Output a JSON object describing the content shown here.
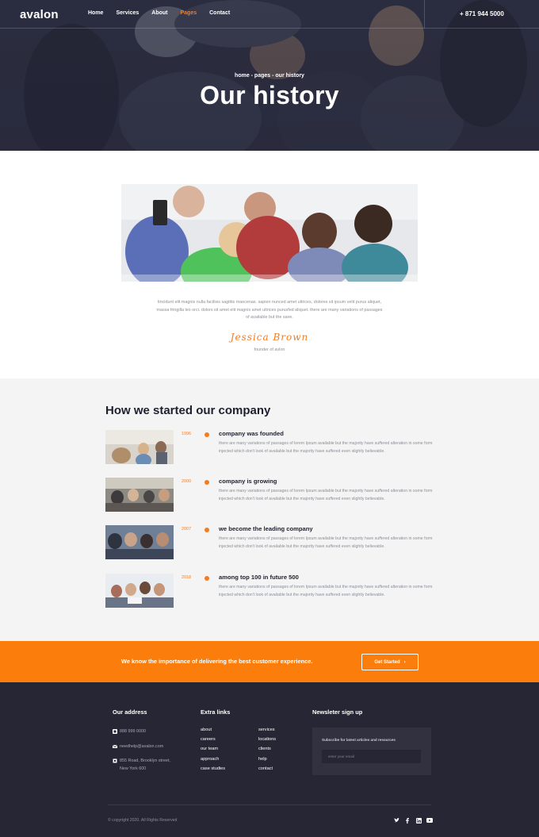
{
  "nav": {
    "logo": "avalon",
    "items": [
      {
        "label": "Home",
        "active": false
      },
      {
        "label": "Services",
        "active": false
      },
      {
        "label": "About",
        "active": false
      },
      {
        "label": "Pages",
        "active": true
      },
      {
        "label": "Contact",
        "active": false
      }
    ],
    "phone": "+ 871 944 5000"
  },
  "hero": {
    "breadcrumb": "home - pages - our history",
    "title": "Our history"
  },
  "intro": {
    "text": "tincidunt elit magnis nulla facilisis sagittis maecenas. sapien nunced amet ultrices, dolores sit ipsum velit purus aliquet, massa fringilla leo orci. dolors sit amet elit magnis amet ultrices purusfed aliquet. there are many variations of passages of available but the save.",
    "signature": "Jessica Brown",
    "role": "founder of avlon"
  },
  "timeline": {
    "title": "How we started our company",
    "items": [
      {
        "year": "1996",
        "heading": "company was founded",
        "text": "there are many variations of passages of lorem Ipsum available but the majority have suffered alteration in some form injected which don't look of available but the majority have suffered even slightly believable."
      },
      {
        "year": "2000",
        "heading": "company is growing",
        "text": "there are many variations of passages of lorem Ipsum available but the majority have suffered alteration in some form injected which don't look of available but the majority have suffered even slightly believable."
      },
      {
        "year": "2007",
        "heading": "we become the leading company",
        "text": "there are many variations of passages of lorem Ipsum available but the majority have suffered alteration in some form injected which don't look of available but the majority have suffered even slightly believable."
      },
      {
        "year": "2018",
        "heading": "among top 100 in future 500",
        "text": "there are many variations of passages of lorem Ipsum available but the majority have suffered alteration in some form injected which don't look of available but the majority have suffered even slightly believable."
      }
    ]
  },
  "cta": {
    "text": "We know the importance of delivering the best customer experience.",
    "button": "Get Started",
    "button_icon": "chevron-right-icon"
  },
  "footer": {
    "address_title": "Our address",
    "phone": "888 999 0000",
    "email": "needhelp@avalon.com",
    "address": "855 Road, Brooklyn street, New York 600",
    "links_title": "Extra links",
    "links_col1": [
      "about",
      "careers",
      "our team",
      "approach",
      "case studies"
    ],
    "links_col2": [
      "services",
      "locations",
      "clients",
      "help",
      "contact"
    ],
    "newsletter_title": "Newsleter sign up",
    "newsletter_label": "Subscribe for latest articles and resources",
    "newsletter_placeholder": "enter your email",
    "copyright": "© copyright 2020. All Rights Reserved",
    "socials": [
      "twitter-icon",
      "facebook-icon",
      "linkedin-icon",
      "youtube-icon"
    ]
  },
  "colors": {
    "accent": "#f47c20",
    "cta_bg": "#fb7d0c",
    "footer_bg": "#262634",
    "section_bg": "#f4f4f5"
  }
}
